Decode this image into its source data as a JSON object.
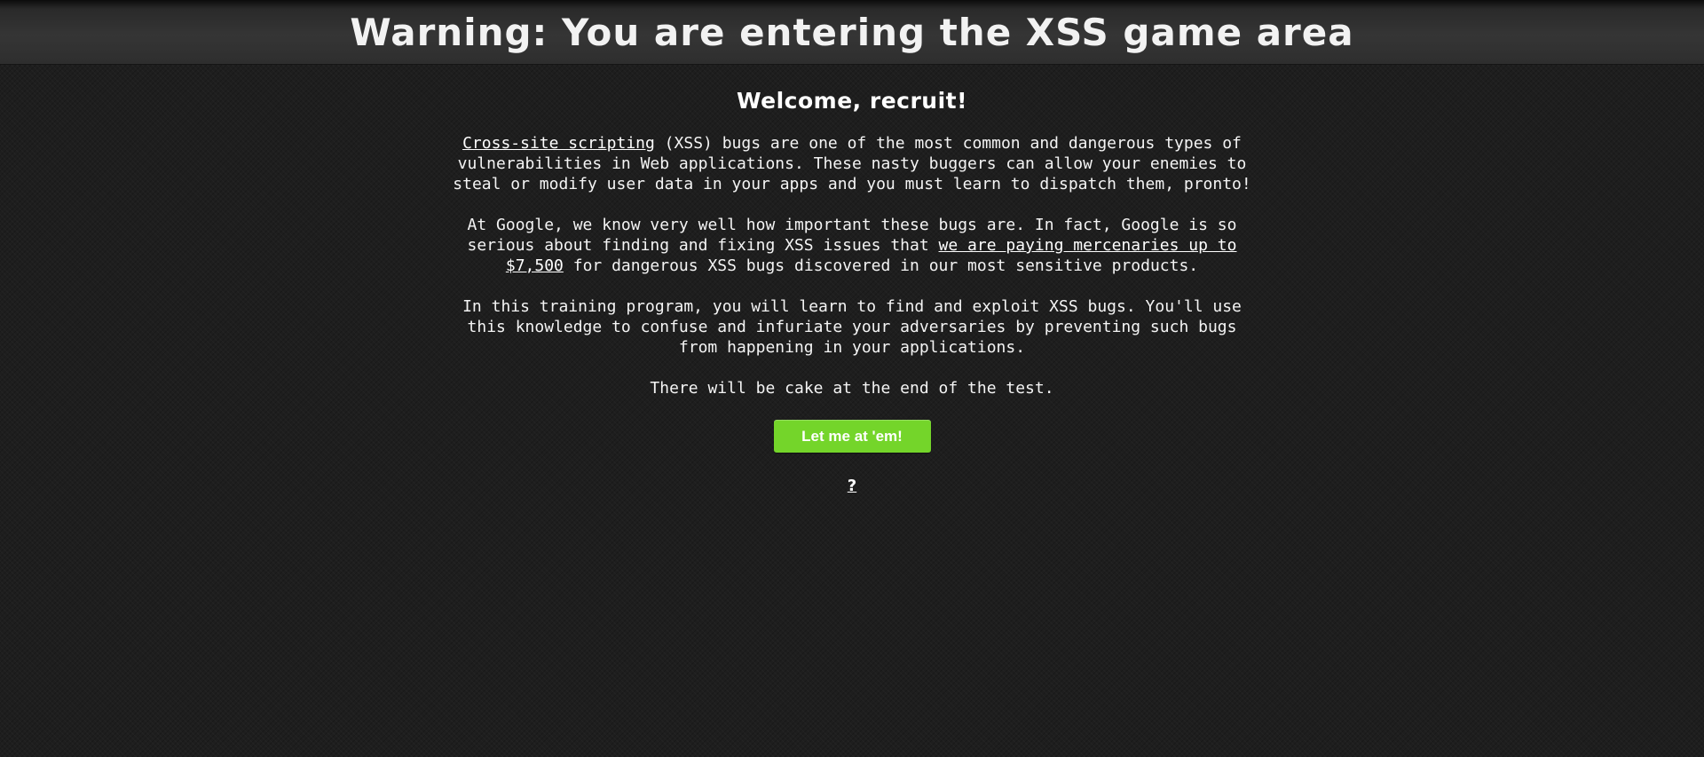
{
  "header": {
    "title": "Warning: You are entering the XSS game area"
  },
  "main": {
    "welcome": "Welcome, recruit!",
    "intro": {
      "link_text": "Cross-site scripting",
      "text": " (XSS) bugs are one of the most common and dangerous types of vulnerabilities in Web applications. These nasty buggers can allow your enemies to steal or modify user data in your apps and you must learn to dispatch them, pronto!"
    },
    "google": {
      "text_before": "At Google, we know very well how important these bugs are. In fact, Google is so serious about finding and fixing XSS issues that ",
      "link_text": "we are paying mercenaries up to $7,500",
      "text_after": " for dangerous XSS bugs discovered in our most sensitive products."
    },
    "training": "In this training program, you will learn to find and exploit XSS bugs. You'll use this knowledge to confuse and infuriate your adversaries by preventing such bugs from happening in your applications.",
    "cake": "There will be cake at the end of the test.",
    "start_button_label": "Let me at 'em!",
    "help_link_text": "?"
  },
  "colors": {
    "background": "#1e1e1e",
    "header": "#333333",
    "button": "#74d52a",
    "text": "#ffffff"
  }
}
